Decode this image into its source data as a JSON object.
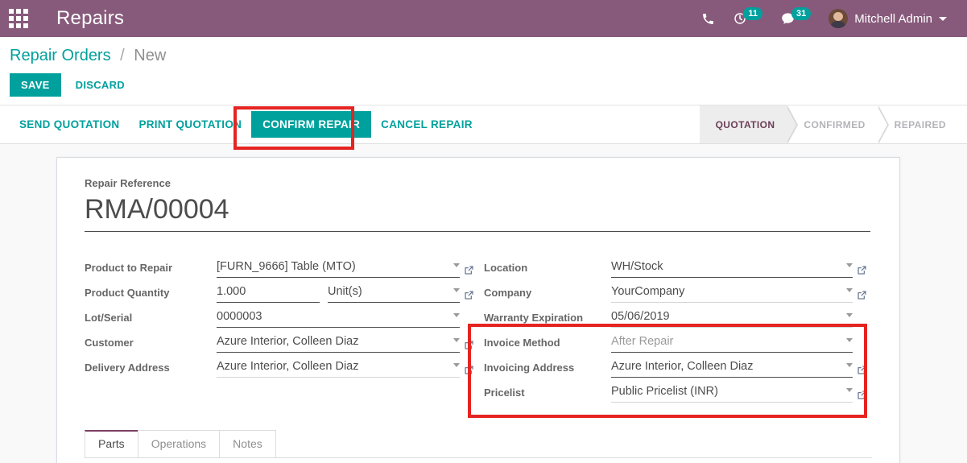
{
  "navbar": {
    "apps_icon": "apps-grid-icon",
    "brand": "Repairs",
    "phone_icon": "phone-icon",
    "activity_icon": "clock-activity-icon",
    "activity_count": "11",
    "messages_icon": "chat-bubble-icon",
    "messages_count": "31",
    "user_name": "Mitchell Admin",
    "purple": "#875A7B",
    "teal": "#00A09D"
  },
  "control_panel": {
    "breadcrumb_root": "Repair Orders",
    "breadcrumb_sep": "/",
    "breadcrumb_current": "New",
    "save_label": "SAVE",
    "discard_label": "DISCARD"
  },
  "actions": {
    "send_quotation": "SEND QUOTATION",
    "print_quotation": "PRINT QUOTATION",
    "confirm_repair": "CONFIRM REPAIR",
    "cancel_repair": "CANCEL REPAIR"
  },
  "status_bar": {
    "stages": [
      {
        "label": "QUOTATION",
        "active": true
      },
      {
        "label": "CONFIRMED",
        "active": false
      },
      {
        "label": "REPAIRED",
        "active": false
      }
    ]
  },
  "form": {
    "title_label": "Repair Reference",
    "title_value": "RMA/00004",
    "left_fields": [
      {
        "label": "Product to Repair",
        "value": "[FURN_9666] Table (MTO)",
        "caret": true,
        "ext_link": true,
        "underline": "dark"
      },
      {
        "label": "Product Quantity",
        "value": "1.000",
        "value2": "Unit(s)",
        "caret": true,
        "ext_link": true,
        "underline": "dark"
      },
      {
        "label": "Lot/Serial",
        "value": "0000003",
        "caret": true,
        "ext_link": false,
        "underline": "dark"
      },
      {
        "label": "Customer",
        "value": "Azure Interior, Colleen Diaz",
        "caret": true,
        "ext_link": true,
        "underline": "dark"
      },
      {
        "label": "Delivery Address",
        "value": "Azure Interior, Colleen Diaz",
        "caret": true,
        "ext_link": true,
        "underline": "light"
      }
    ],
    "right_fields": [
      {
        "label": "Location",
        "value": "WH/Stock",
        "caret": true,
        "ext_link": true,
        "underline": "dark"
      },
      {
        "label": "Company",
        "value": "YourCompany",
        "caret": true,
        "ext_link": true,
        "underline": "light"
      },
      {
        "label": "Warranty Expiration",
        "value": "05/06/2019",
        "caret": true,
        "ext_link": false,
        "underline": "light"
      },
      {
        "label": "Invoice Method",
        "value": "After Repair",
        "caret": true,
        "ext_link": false,
        "underline": "dark",
        "muted": true
      },
      {
        "label": "Invoicing Address",
        "value": "Azure Interior, Colleen Diaz",
        "caret": true,
        "ext_link": true,
        "underline": "dark"
      },
      {
        "label": "Pricelist",
        "value": "Public Pricelist (INR)",
        "caret": true,
        "ext_link": true,
        "underline": "light"
      }
    ]
  },
  "tabs": [
    {
      "label": "Parts",
      "active": true
    },
    {
      "label": "Operations",
      "active": false
    },
    {
      "label": "Notes",
      "active": false
    }
  ],
  "highlights": {
    "color": "#E52421",
    "confirm_repair_box": "CONFIRM REPAIR button",
    "invoice_group_box": "Invoice Method / Invoicing Address / Pricelist group"
  }
}
